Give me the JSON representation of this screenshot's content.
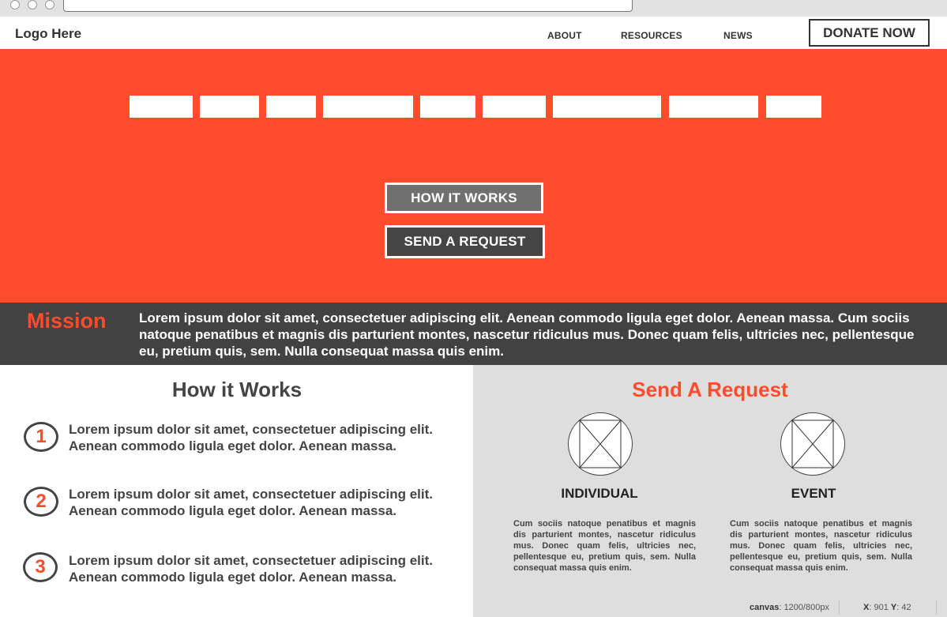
{
  "header": {
    "logo": "Logo Here",
    "nav": [
      "ABOUT",
      "RESOURCES",
      "NEWS"
    ],
    "donate": "DONATE NOW"
  },
  "hero": {
    "how_button": "HOW IT WORKS",
    "request_button": "SEND A REQUEST",
    "accent": "#ff4c2c"
  },
  "mission": {
    "title": "Mission",
    "text": "Lorem ipsum dolor sit amet, consectetuer adipiscing elit. Aenean commodo ligula eget dolor. Aenean massa. Cum sociis natoque penatibus et magnis dis parturient montes, nascetur ridiculus mus. Donec quam felis, ultricies nec, pellentesque eu, pretium quis, sem. Nulla consequat massa quis enim."
  },
  "how": {
    "title": "How it Works",
    "steps": [
      {
        "num": "1",
        "text": "Lorem ipsum dolor sit amet, consectetuer adipiscing elit. Aenean commodo ligula eget dolor. Aenean massa."
      },
      {
        "num": "2",
        "text": "Lorem ipsum dolor sit amet, consectetuer adipiscing elit. Aenean commodo ligula eget dolor. Aenean massa."
      },
      {
        "num": "3",
        "text": "Lorem ipsum dolor sit amet, consectetuer adipiscing elit. Aenean commodo ligula eget dolor. Aenean massa."
      }
    ]
  },
  "request": {
    "title": "Send A Request",
    "options": [
      {
        "label": "INDIVIDUAL",
        "icon": "image-placeholder-icon",
        "desc": "Cum sociis natoque penatibus et magnis dis parturient montes, nascetur ridiculus mus. Donec quam felis, ultricies nec, pellentesque eu, pretium quis, sem. Nulla consequat massa quis enim."
      },
      {
        "label": "EVENT",
        "icon": "image-placeholder-icon",
        "desc": "Cum sociis natoque penatibus et magnis dis parturient montes, nascetur ridiculus mus. Donec quam felis, ultricies nec, pellentesque eu, pretium quis, sem. Nulla consequat massa quis enim."
      }
    ]
  },
  "status": {
    "canvas_label": "canvas",
    "canvas_value": "1200/800px",
    "x_label": "X",
    "x_value": "901",
    "y_label": "Y",
    "y_value": "42"
  }
}
